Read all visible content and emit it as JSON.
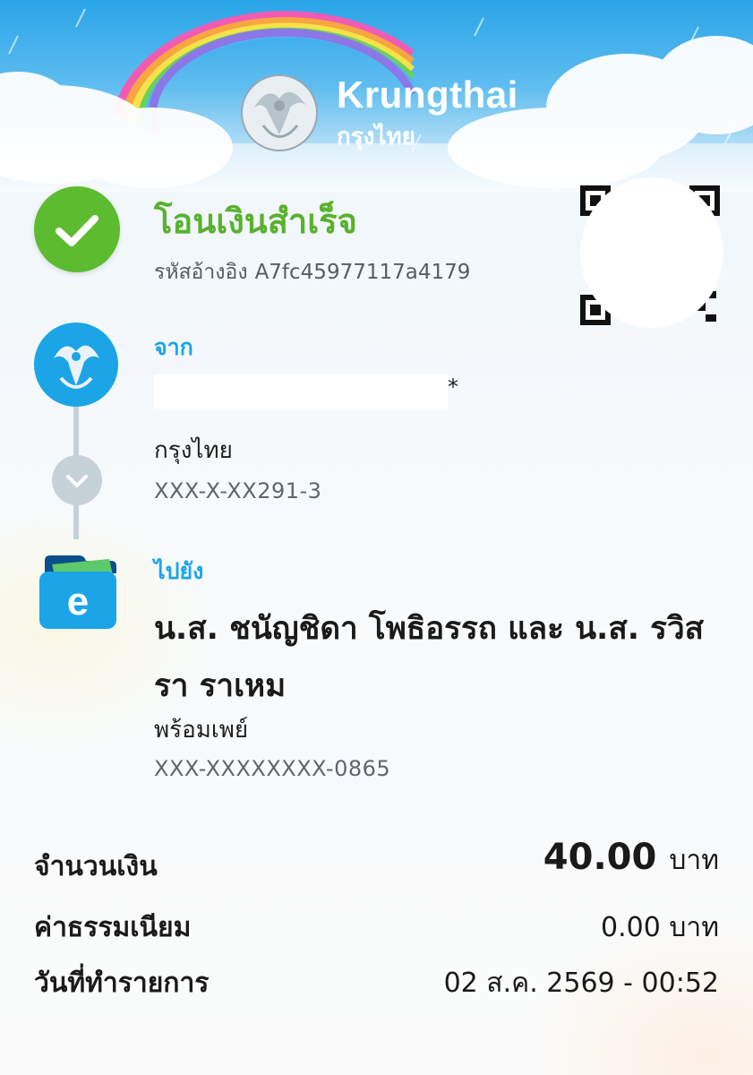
{
  "header": {
    "brand_en": "Krungthai",
    "brand_th": "กรุงไทย",
    "logo_icon": "krungthai-phoenix-logo"
  },
  "status": {
    "title": "โอนเงินสำเร็จ",
    "ref_label": "รหัสอ้างอิง",
    "ref_value": "A7fc45977117a4179",
    "icon": "check-circle-icon"
  },
  "from": {
    "label": "จาก",
    "masked_suffix": "*",
    "bank": "กรุงไทย",
    "account": "XXX-X-XX291-3"
  },
  "to": {
    "label": "ไปยัง",
    "name": "น.ส. ชนัญชิดา โพธิอรรถ และ น.ส. รวิสรา ราเหม",
    "service": "พร้อมเพย์",
    "account": "XXX-XXXXXXXX-0865"
  },
  "summary": {
    "amount_label": "จำนวนเงิน",
    "amount_value": "40.00",
    "amount_unit": "บาท",
    "fee_label": "ค่าธรรมเนียม",
    "fee_value": "0.00 บาท",
    "date_label": "วันที่ทำรายการ",
    "date_value": "02 ส.ค. 2569 - 00:52"
  },
  "colors": {
    "success_green": "#5dbb30",
    "accent_blue": "#1ba5e6",
    "timeline_grey": "#c6d1d8"
  }
}
